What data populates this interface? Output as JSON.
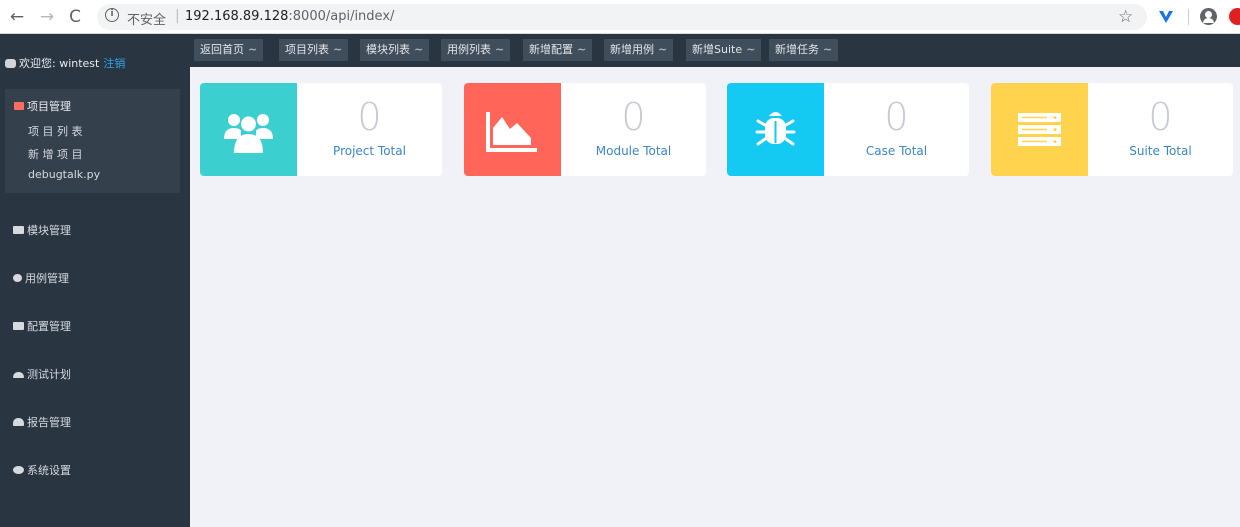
{
  "browser": {
    "insecure_label": "不安全",
    "separator": "|",
    "url_host": "192.168.89.128",
    "url_rest": ":8000/api/index/"
  },
  "sidebar": {
    "welcome_prefix": "欢迎您: wintest",
    "logout_label": "注销",
    "project_menu": {
      "label": "项目管理",
      "items": [
        "项 目 列 表",
        "新 增 项 目",
        "debugtalk.py"
      ]
    },
    "menus": [
      {
        "label": "模块管理",
        "icon": "list-icon"
      },
      {
        "label": "用例管理",
        "icon": "bug-icon"
      },
      {
        "label": "配置管理",
        "icon": "tag-icon"
      },
      {
        "label": "测试计划",
        "icon": "cloud-icon"
      },
      {
        "label": "报告管理",
        "icon": "cloud-upload-icon"
      },
      {
        "label": "系统设置",
        "icon": "gears-icon"
      }
    ]
  },
  "topnav": {
    "tabs": [
      "返回首页",
      "项目列表",
      "模块列表",
      "用例列表",
      "新增配置",
      "新增用例",
      "新增Suite",
      "新增任务"
    ],
    "tilde": "~"
  },
  "cards": [
    {
      "value": "0",
      "label": "Project Total",
      "color": "#3ccfcf",
      "label_color": "#3a86c8",
      "icon": "users-icon"
    },
    {
      "value": "0",
      "label": "Module Total",
      "color": "#ff6559",
      "label_color": "#3a86c8",
      "icon": "area-chart-icon"
    },
    {
      "value": "0",
      "label": "Case Total",
      "color": "#14c9f2",
      "label_color": "#3a86c8",
      "icon": "bug-icon"
    },
    {
      "value": "0",
      "label": "Suite Total",
      "color": "#ffd34d",
      "label_color": "#3a86c8",
      "icon": "server-icon"
    }
  ]
}
